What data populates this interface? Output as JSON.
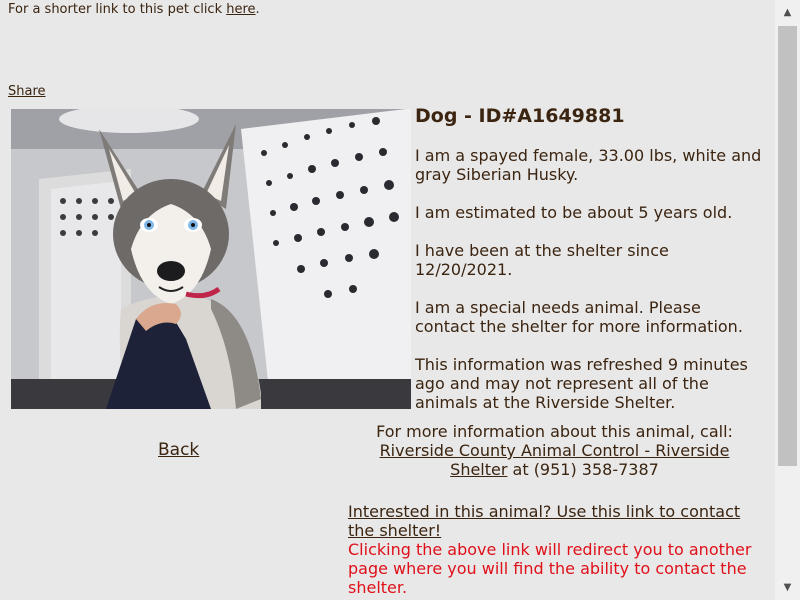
{
  "short_link": {
    "prefix": "For a shorter link to this pet click ",
    "link_text": "here",
    "suffix": "."
  },
  "share_label": "Share",
  "pet": {
    "heading": "Dog - ID#A1649881",
    "description": "I am a spayed female, 33.00 lbs, white and gray Siberian Husky.",
    "age": "I am estimated to be about 5 years old.",
    "shelter_since": "I have been at the shelter since 12/20/2021.",
    "special_needs": "I am a special needs animal. Please contact the shelter for more information.",
    "refresh_note": "This information was refreshed 9 minutes ago and may not represent all of the animals at the Riverside Shelter."
  },
  "back_label": "Back",
  "contact": {
    "intro": "For more information about this animal, call:",
    "shelter_link": "Riverside County Animal Control - Riverside Shelter",
    "phone": " at (951) 358-7387"
  },
  "interested": {
    "link_text": "Interested in this animal? Use this link to contact the shelter!",
    "redirect_note": "Clicking the above link will redirect you to another page where you will find the ability to contact the shelter."
  },
  "colors": {
    "text": "#3b2410",
    "warning": "#e0101a",
    "background": "#e8e8e8"
  }
}
